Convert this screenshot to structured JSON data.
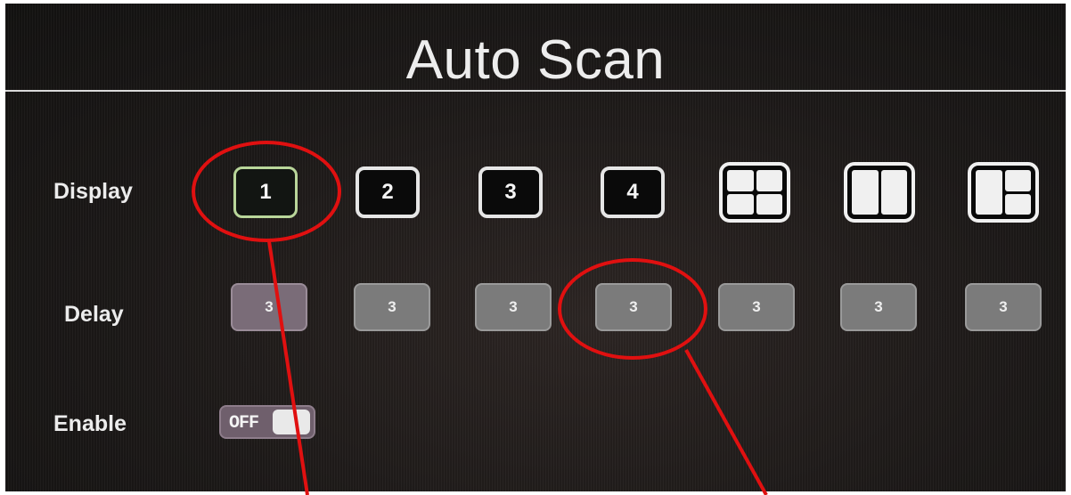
{
  "title": "Auto Scan",
  "rows": {
    "display_label": "Display",
    "delay_label": "Delay",
    "enable_label": "Enable"
  },
  "display_buttons": [
    "1",
    "2",
    "3",
    "4"
  ],
  "display_layouts": [
    "quad-split",
    "dual-split",
    "triple-split"
  ],
  "selected_display": "1",
  "delay_values": [
    "3",
    "3",
    "3",
    "3",
    "3",
    "3",
    "3"
  ],
  "enable_toggle": {
    "text": "OFF",
    "state": "off"
  },
  "colors": {
    "annotation": "#e01010",
    "selected_border": "#b9d69a",
    "background": "#1b1817"
  }
}
